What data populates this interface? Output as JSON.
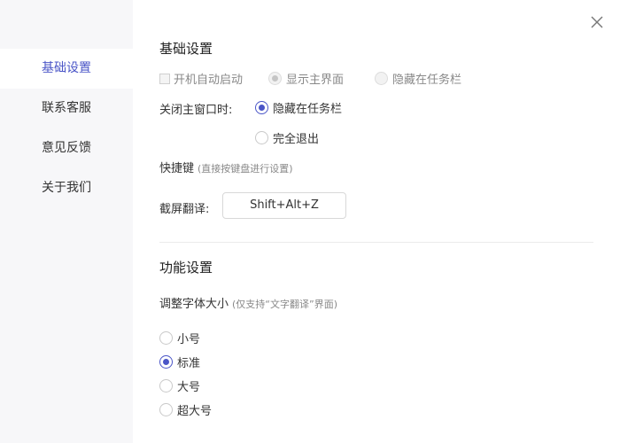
{
  "sidebar": {
    "items": [
      {
        "label": "基础设置",
        "active": true
      },
      {
        "label": "联系客服"
      },
      {
        "label": "意见反馈"
      },
      {
        "label": "关于我们"
      }
    ]
  },
  "basic": {
    "title": "基础设置",
    "startup_label": "开机自动启动",
    "show_main_label": "显示主界面",
    "hide_taskbar_label": "隐藏在任务栏",
    "close_main_label": "关闭主窗口时:",
    "close_hide_label": "隐藏在任务栏",
    "close_exit_label": "完全退出",
    "shortcut_title": "快捷键",
    "shortcut_hint": "(直接按键盘进行设置)",
    "screenshot_translate_label": "截屏翻译:",
    "screenshot_translate_value": "Shift+Alt+Z"
  },
  "feature": {
    "title": "功能设置",
    "font_size_label": "调整字体大小",
    "font_size_hint": "(仅支持“文字翻译”界面)",
    "options": [
      "小号",
      "标准",
      "大号",
      "超大号"
    ],
    "selected": "标准"
  },
  "colors": {
    "accent": "#4a55c7",
    "sidebar_bg": "#f7f7f9"
  },
  "icons": {
    "close": "close-icon"
  }
}
